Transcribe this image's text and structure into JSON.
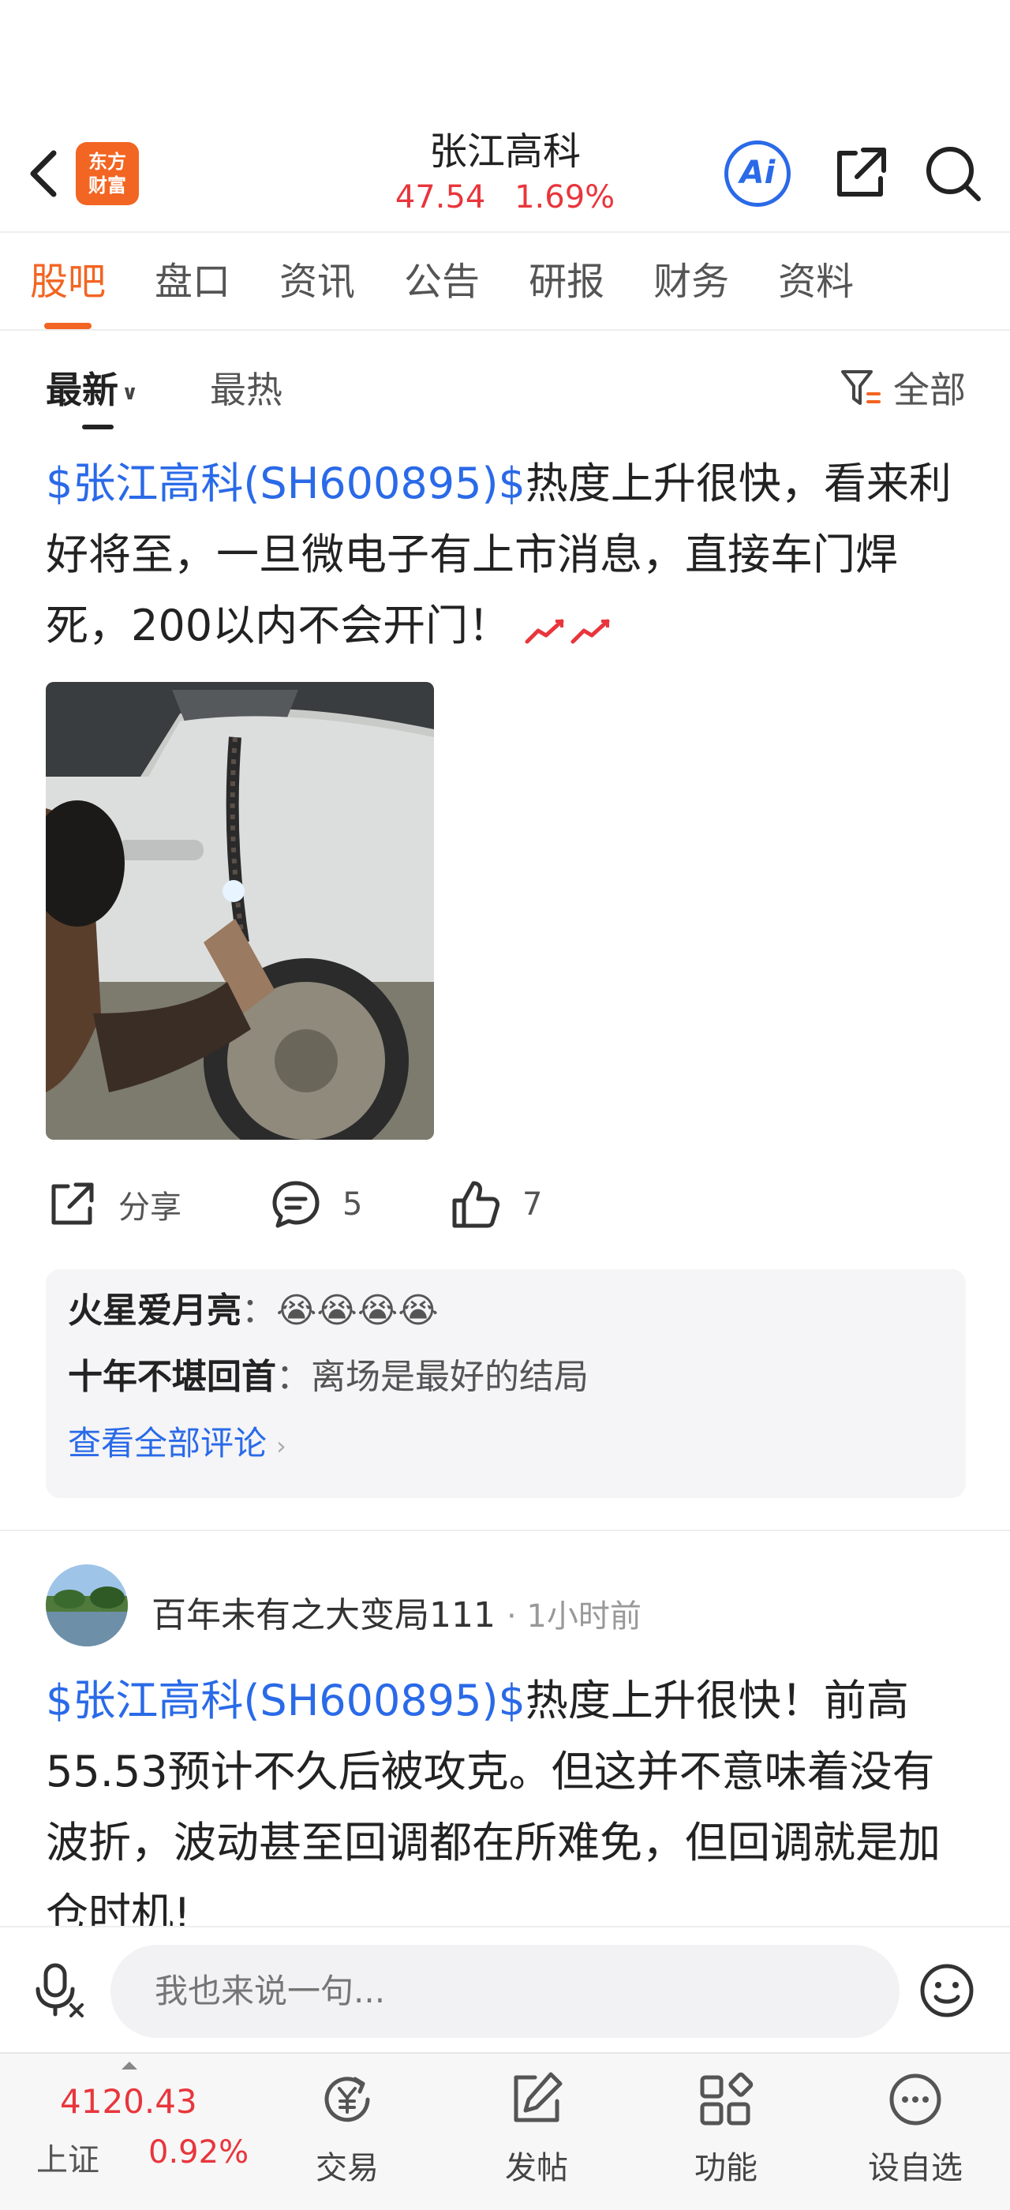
{
  "header": {
    "logo_line1": "东方",
    "logo_line2": "财富",
    "stock_name": "张江高科",
    "price": "47.54",
    "change_pct": "1.69%",
    "ai_label": "Ai"
  },
  "tabs": [
    {
      "label": "股吧",
      "active": true
    },
    {
      "label": "盘口"
    },
    {
      "label": "资讯"
    },
    {
      "label": "公告"
    },
    {
      "label": "研报"
    },
    {
      "label": "财务"
    },
    {
      "label": "资料"
    }
  ],
  "sort": {
    "latest": "最新",
    "hottest": "最热",
    "filter": "全部"
  },
  "post1": {
    "tag": "$张江高科(SH600895)$",
    "text": "热度上升很快，看来利好将至，一旦微电子有上市消息，直接车门焊死，200以内不会开门！",
    "actions": {
      "share": "分享",
      "comments": "5",
      "likes": "7"
    },
    "comments": [
      {
        "user": "火星爱月亮",
        "sep": "：",
        "text": "😭😭😭😭"
      },
      {
        "user": "十年不堪回首",
        "sep": "：",
        "text": "离场是最好的结局"
      }
    ],
    "view_all": "查看全部评论"
  },
  "post2": {
    "user": "百年未有之大变局111",
    "time": "· 1小时前",
    "tag": "$张江高科(SH600895)$",
    "text": "热度上升很快！前高55.53预计不久后被攻克。但这并不意味着没有波折，波动甚至回调都在所难免，但回调就是加仓时机!"
  },
  "input": {
    "placeholder": "我也来说一句..."
  },
  "bottom_nav": {
    "index_value": "4120.43",
    "index_name": "上证",
    "index_pct": "0.92%",
    "items": [
      {
        "label": "交易",
        "icon": "yuan-cycle-icon"
      },
      {
        "label": "发帖",
        "icon": "edit-icon"
      },
      {
        "label": "功能",
        "icon": "grid-icon"
      },
      {
        "label": "设自选",
        "icon": "more-icon"
      }
    ]
  },
  "colors": {
    "accent_orange": "#f26522",
    "up_red": "#e8363c",
    "link_blue": "#2a6ae8"
  }
}
